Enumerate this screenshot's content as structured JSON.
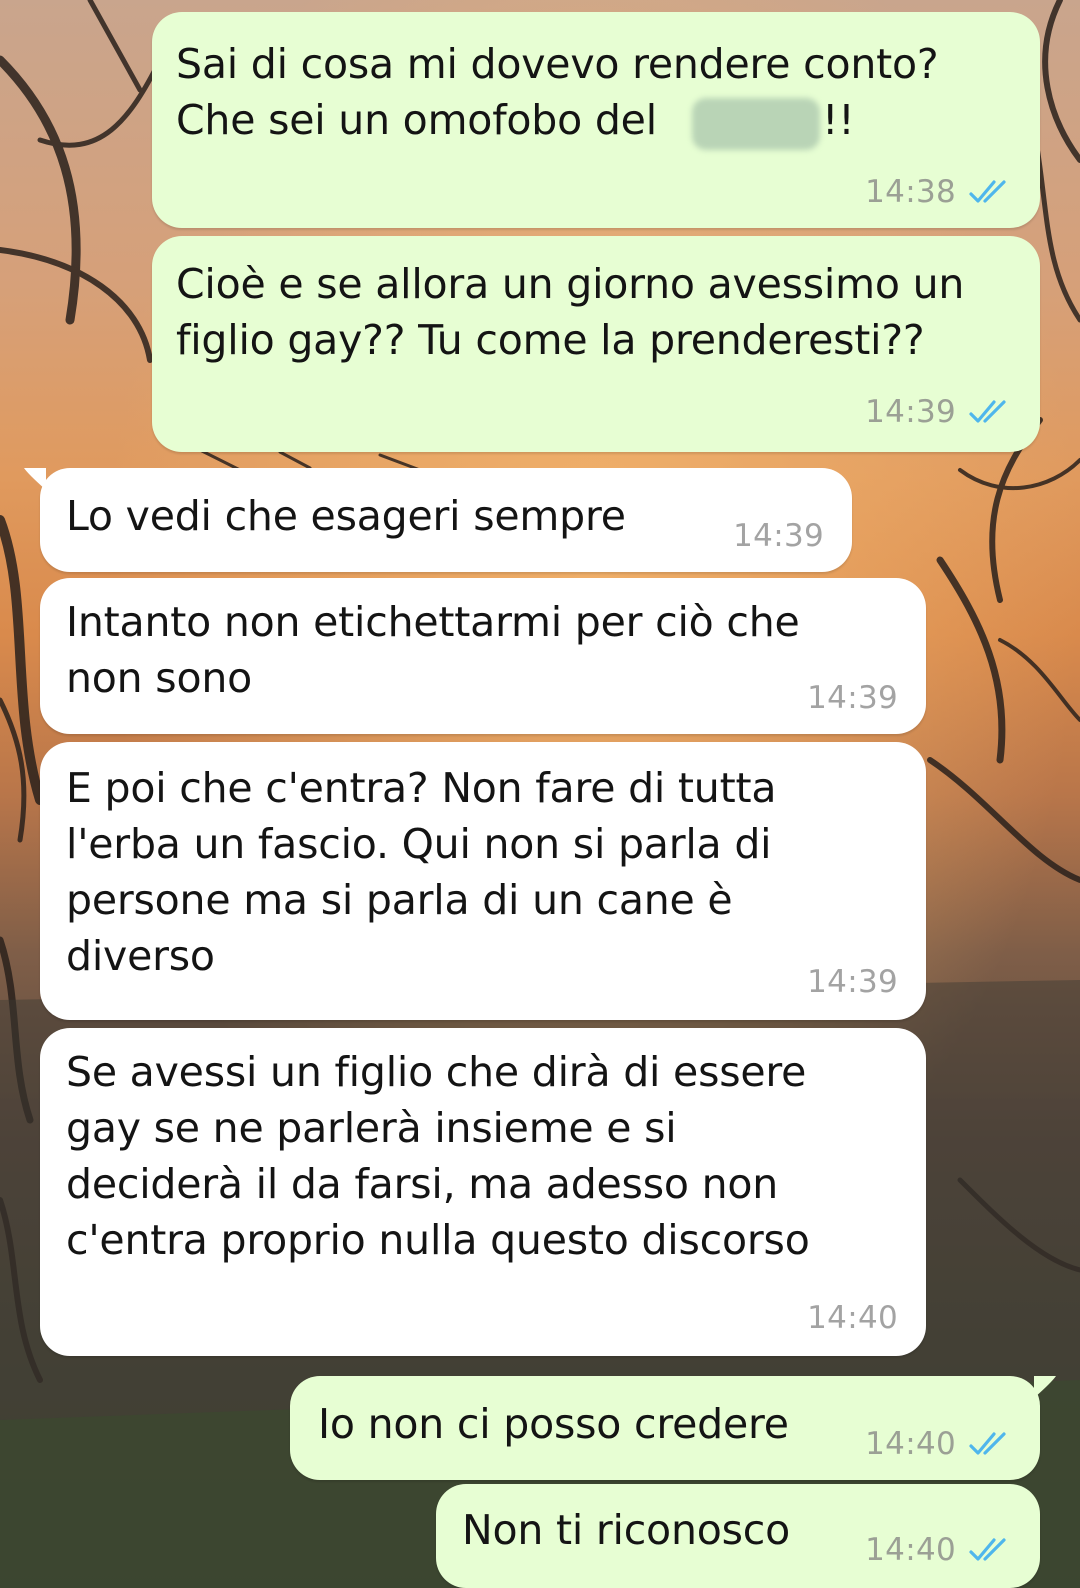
{
  "chat": {
    "messages": [
      {
        "direction": "outgoing",
        "lines": [
          "Sai di cosa mi dovevo rendere conto?",
          "Che sei un omofobo del ",
          "!!"
        ],
        "time": "14:38",
        "status": "read",
        "redacted": true
      },
      {
        "direction": "outgoing",
        "lines": [
          "Cioè e se allora un giorno avessimo un",
          "figlio gay?? Tu come la prenderesti??"
        ],
        "time": "14:39",
        "status": "read"
      },
      {
        "direction": "incoming",
        "lines": [
          "Lo vedi che esageri sempre"
        ],
        "time": "14:39"
      },
      {
        "direction": "incoming",
        "lines": [
          "Intanto non etichettarmi per ciò che",
          "non sono"
        ],
        "time": "14:39"
      },
      {
        "direction": "incoming",
        "lines": [
          "E poi che c'entra? Non fare di tutta",
          "l'erba un fascio. Qui non si parla di",
          "persone ma si parla di un cane è",
          "diverso"
        ],
        "time": "14:39"
      },
      {
        "direction": "incoming",
        "lines": [
          "Se avessi un figlio che dirà di essere",
          "gay se ne parlerà insieme e si",
          "deciderà il da farsi, ma adesso non",
          "c'entra proprio nulla questo discorso"
        ],
        "time": "14:40"
      },
      {
        "direction": "outgoing",
        "lines": [
          "Io non ci posso credere"
        ],
        "time": "14:40",
        "status": "read"
      },
      {
        "direction": "outgoing",
        "lines": [
          "Non ti riconosco"
        ],
        "time": "14:40",
        "status": "read"
      }
    ]
  },
  "icons": {
    "read_receipt": "double-check-icon"
  },
  "colors": {
    "outgoing_bubble": "#e7fed3",
    "incoming_bubble": "#ffffff",
    "read_tick": "#4fb6ec",
    "text": "#141414"
  }
}
